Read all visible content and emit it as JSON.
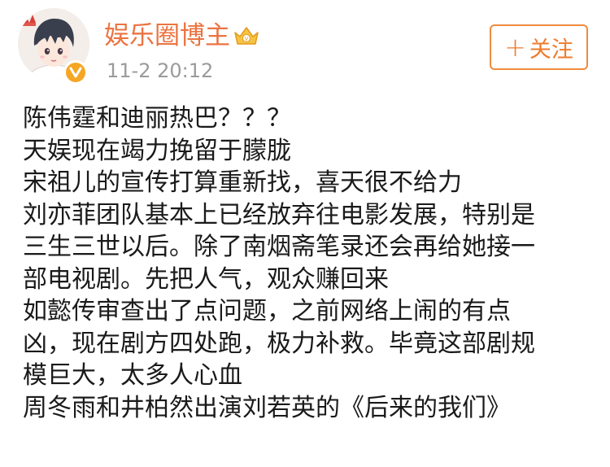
{
  "author": {
    "name": "娱乐圈博主",
    "avatar_icon": "avatar-cartoon-boy",
    "verified_icon": "verified-v-icon",
    "rank_icon": "crown-icon"
  },
  "post": {
    "time": "11-2 20:12",
    "lines": [
      "陈伟霆和迪丽热巴？？？",
      "天娱现在竭力挽留于朦胧",
      "宋祖儿的宣传打算重新找，喜天很不给力",
      "刘亦菲团队基本上已经放弃往电影发展，特别是",
      "三生三世以后。除了南烟斋笔录还会再给她接一",
      "部电视剧。先把人气，观众赚回来",
      "如懿传审查出了点问题，之前网络上闹的有点",
      "凶，现在剧方四处跑，极力补救。毕竟这部剧规",
      "模巨大，太多人心血",
      "周冬雨和井柏然出演刘若英的《后来的我们》"
    ]
  },
  "actions": {
    "follow_plus": "+",
    "follow_label": "关注"
  },
  "colors": {
    "name": "#eb7340",
    "accent": "#f08b3f",
    "time": "#9b9b9b",
    "text": "#1a1a1a",
    "badge": "#f5a623"
  }
}
